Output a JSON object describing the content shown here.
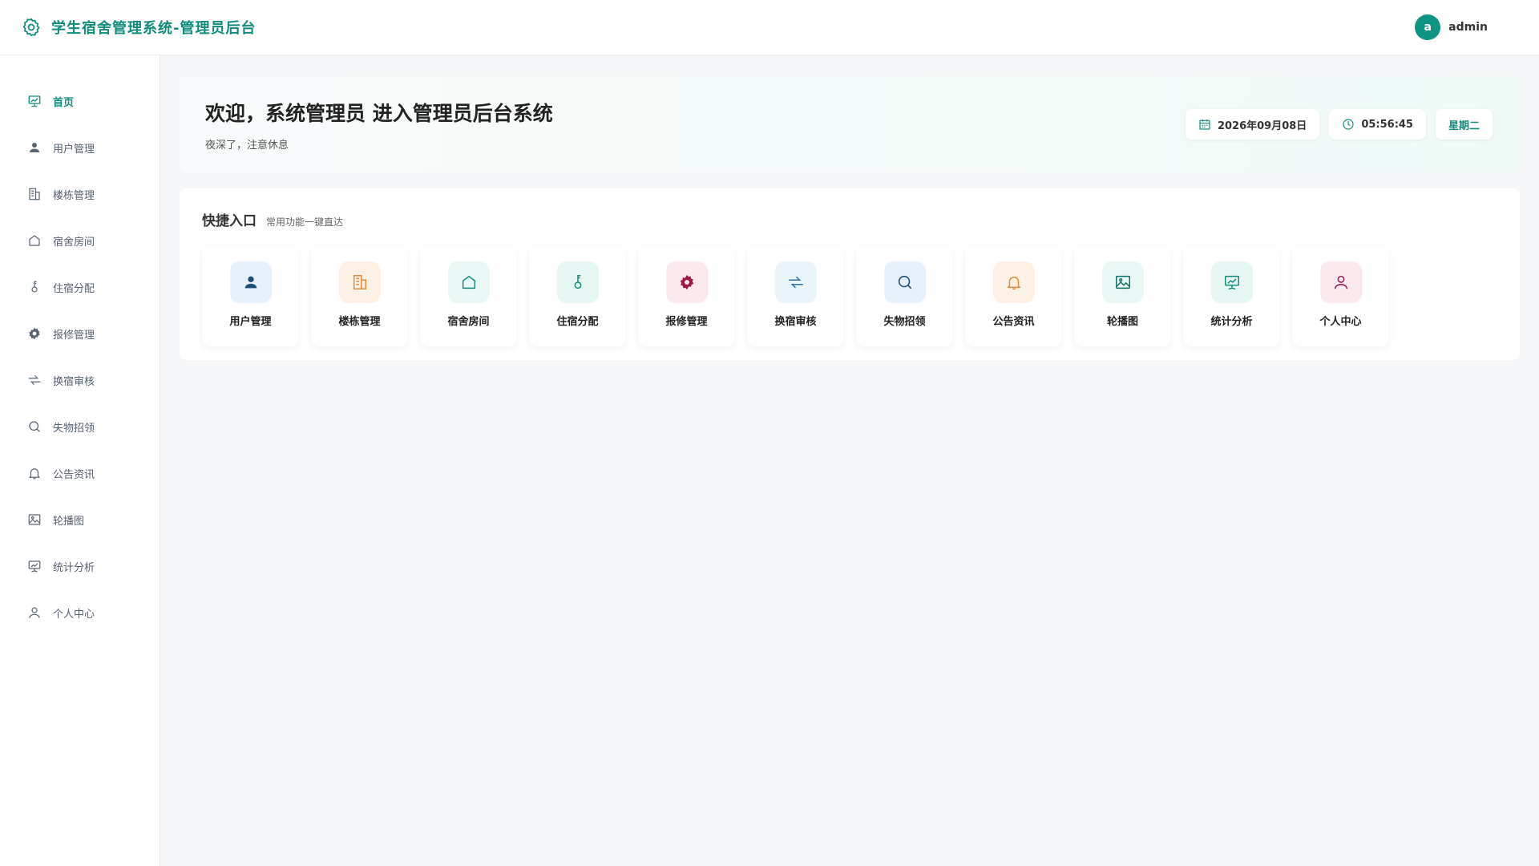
{
  "header": {
    "title": "学生宿舍管理系统-管理员后台",
    "user": {
      "avatar_letter": "a",
      "name": "admin"
    }
  },
  "colors": {
    "accent": "#118b7a"
  },
  "sidebar": {
    "items": [
      {
        "label": "首页",
        "icon": "presentation-chart-icon",
        "active": true
      },
      {
        "label": "用户管理",
        "icon": "user-icon"
      },
      {
        "label": "楼栋管理",
        "icon": "building-icon"
      },
      {
        "label": "宿舍房间",
        "icon": "house-icon"
      },
      {
        "label": "住宿分配",
        "icon": "key-icon"
      },
      {
        "label": "报修管理",
        "icon": "gear-icon"
      },
      {
        "label": "换宿审核",
        "icon": "swap-icon"
      },
      {
        "label": "失物招领",
        "icon": "search-icon"
      },
      {
        "label": "公告资讯",
        "icon": "bell-icon"
      },
      {
        "label": "轮播图",
        "icon": "image-icon"
      },
      {
        "label": "统计分析",
        "icon": "presentation-chart-icon"
      },
      {
        "label": "个人中心",
        "icon": "person-outline-icon"
      }
    ]
  },
  "welcome": {
    "title": "欢迎，系统管理员 进入管理员后台系统",
    "subtitle": "夜深了，注意休息",
    "date": "2026年09月08日",
    "time": "05:56:45",
    "weekday": "星期二"
  },
  "quick": {
    "title": "快捷入口",
    "subtitle": "常用功能一键直达",
    "items": [
      {
        "label": "用户管理",
        "icon": "user-icon",
        "bg": "#e6f1fb",
        "color": "#1f4e79"
      },
      {
        "label": "楼栋管理",
        "icon": "building-icon",
        "bg": "#fdf0e4",
        "color": "#e08a3c"
      },
      {
        "label": "宿舍房间",
        "icon": "house-icon",
        "bg": "#e9f8f4",
        "color": "#118b7a"
      },
      {
        "label": "住宿分配",
        "icon": "key-icon",
        "bg": "#e6f6f2",
        "color": "#118b7a"
      },
      {
        "label": "报修管理",
        "icon": "gear-icon",
        "bg": "#fbe9ee",
        "color": "#a01848"
      },
      {
        "label": "换宿审核",
        "icon": "swap-icon",
        "bg": "#eaf4fb",
        "color": "#2a6fa8"
      },
      {
        "label": "失物招领",
        "icon": "search-icon",
        "bg": "#e6f1fb",
        "color": "#1f4e79"
      },
      {
        "label": "公告资讯",
        "icon": "bell-icon",
        "bg": "#fdf0e4",
        "color": "#e08a3c"
      },
      {
        "label": "轮播图",
        "icon": "image-icon",
        "bg": "#e9f8f4",
        "color": "#0f6e66"
      },
      {
        "label": "统计分析",
        "icon": "presentation-chart-icon",
        "bg": "#e6f6f2",
        "color": "#118b7a"
      },
      {
        "label": "个人中心",
        "icon": "person-outline-icon",
        "bg": "#fbe9ee",
        "color": "#a01848"
      }
    ]
  }
}
